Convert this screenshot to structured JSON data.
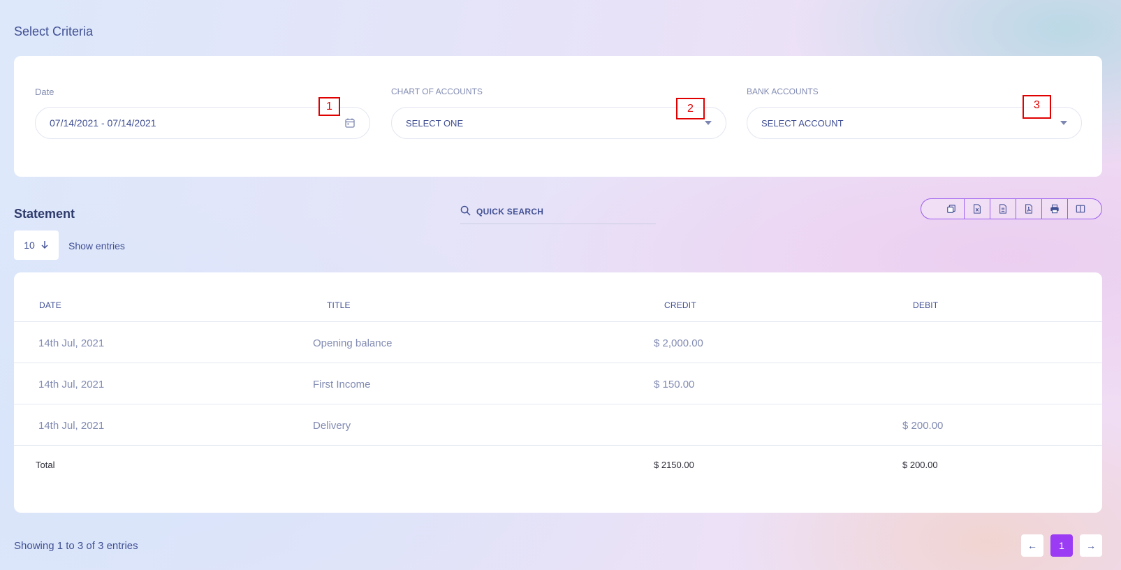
{
  "criteria": {
    "title": "Select Criteria",
    "date": {
      "label": "Date",
      "value": "07/14/2021 - 07/14/2021"
    },
    "chart_of_accounts": {
      "label": "CHART OF ACCOUNTS",
      "value": "SELECT ONE"
    },
    "bank_accounts": {
      "label": "BANK ACCOUNTS",
      "value": "SELECT ACCOUNT"
    }
  },
  "markers": [
    "1",
    "2",
    "3"
  ],
  "statement": {
    "title": "Statement",
    "search_placeholder": "QUICK SEARCH",
    "entries_value": "10",
    "entries_label": "Show entries",
    "toolbar": [
      "copy-icon",
      "excel-icon",
      "csv-icon",
      "pdf-icon",
      "print-icon",
      "columns-icon"
    ],
    "columns": [
      "DATE",
      "TITLE",
      "CREDIT",
      "DEBIT"
    ],
    "rows": [
      {
        "date": "14th Jul, 2021",
        "title": "Opening balance",
        "credit": "$ 2,000.00",
        "debit": ""
      },
      {
        "date": "14th Jul, 2021",
        "title": "First Income",
        "credit": "$ 150.00",
        "debit": ""
      },
      {
        "date": "14th Jul, 2021",
        "title": "Delivery",
        "credit": "",
        "debit": "$ 200.00"
      }
    ],
    "total": {
      "label": "Total",
      "credit": "$ 2150.00",
      "debit": "$ 200.00"
    }
  },
  "pagination": {
    "summary": "Showing 1 to 3 of 3 entries",
    "prev": "←",
    "current": "1",
    "next": "→"
  },
  "colors": {
    "accent": "#9b3cf4",
    "text": "#415094",
    "muted": "#828bb2",
    "marker": "#e00000"
  }
}
